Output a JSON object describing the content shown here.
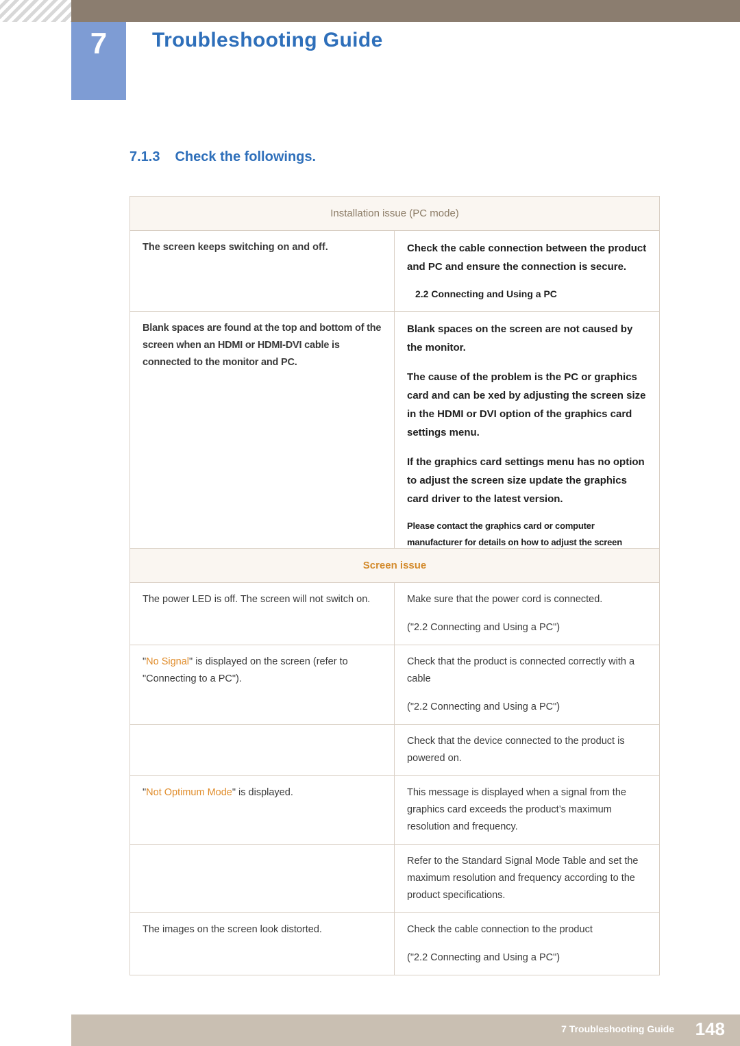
{
  "header": {
    "chapter_number": "7",
    "chapter_title": "Troubleshooting Guide"
  },
  "section": {
    "number": "7.1.3",
    "title": "Check the followings."
  },
  "table_installation": {
    "header": "Installation issue (PC mode)",
    "rows": [
      {
        "left": "The screen keeps switching on and off.",
        "right_paragraphs": [
          "Check the cable connection between the product and PC  and ensure the connection is secure."
        ],
        "right_reference": "2.2 Connecting and Using a PC"
      },
      {
        "left": "Blank spaces are found at the top and bottom of the screen when an HDMI or HDMI-DVI cable is connected to the monitor and PC.",
        "right_paragraphs": [
          "Blank spaces on the screen are not caused by the monitor.",
          "The cause of the problem is the PC or graphics card  and can be  xed by adjusting the screen size in the HDMI or DVI option of the graphics card settings menu.",
          "If the graphics card settings menu has no option to adjust the screen size  update the graphics card driver to the latest version."
        ],
        "right_note": " Please contact the graphics card or computer manufacturer for details on how to adjust the screen settings."
      }
    ]
  },
  "table_screen": {
    "header": "Screen issue",
    "rows": [
      {
        "left_paragraphs": [
          "The power LED is off. The screen will not switch on."
        ],
        "right_paragraphs": [
          "Make sure that the power cord is connected.",
          "(\"2.2 Connecting and Using a PC\")"
        ]
      },
      {
        "left_prefix": "\"",
        "left_highlight": "No Signal",
        "left_suffix": "\" is displayed on the screen (refer to \"Connecting to a PC\").",
        "right_paragraphs": [
          "Check that the product is connected correctly with a cable",
          "(\"2.2 Connecting and Using a PC\")"
        ]
      },
      {
        "left_paragraphs": [],
        "right_paragraphs": [
          "Check that the device connected to the product is powered on."
        ]
      },
      {
        "left_prefix": "\"",
        "left_highlight": "Not Optimum Mode",
        "left_suffix": "\" is displayed.",
        "right_paragraphs": [
          "This message is displayed when a signal from the graphics card exceeds the product’s maximum resolution and frequency."
        ]
      },
      {
        "left_paragraphs": [],
        "right_paragraphs": [
          "Refer to the Standard Signal Mode Table and set the maximum resolution and frequency according to the product specifications."
        ]
      },
      {
        "left_paragraphs": [
          "The images on the screen look distorted."
        ],
        "right_paragraphs": [
          "Check the cable connection to the product",
          "(\"2.2 Connecting and Using a PC\")"
        ]
      }
    ]
  },
  "footer": {
    "label": "7 Troubleshooting Guide",
    "page": "148"
  },
  "colors": {
    "heading_blue": "#2e6fba",
    "badge_blue": "#7e9cd4",
    "header_brown": "#8b7d6f",
    "footer_gray": "#c9bfb2",
    "accent_orange": "#e08c2a",
    "table_border": "#d9cfc4",
    "table_header_bg": "#faf6f1"
  }
}
